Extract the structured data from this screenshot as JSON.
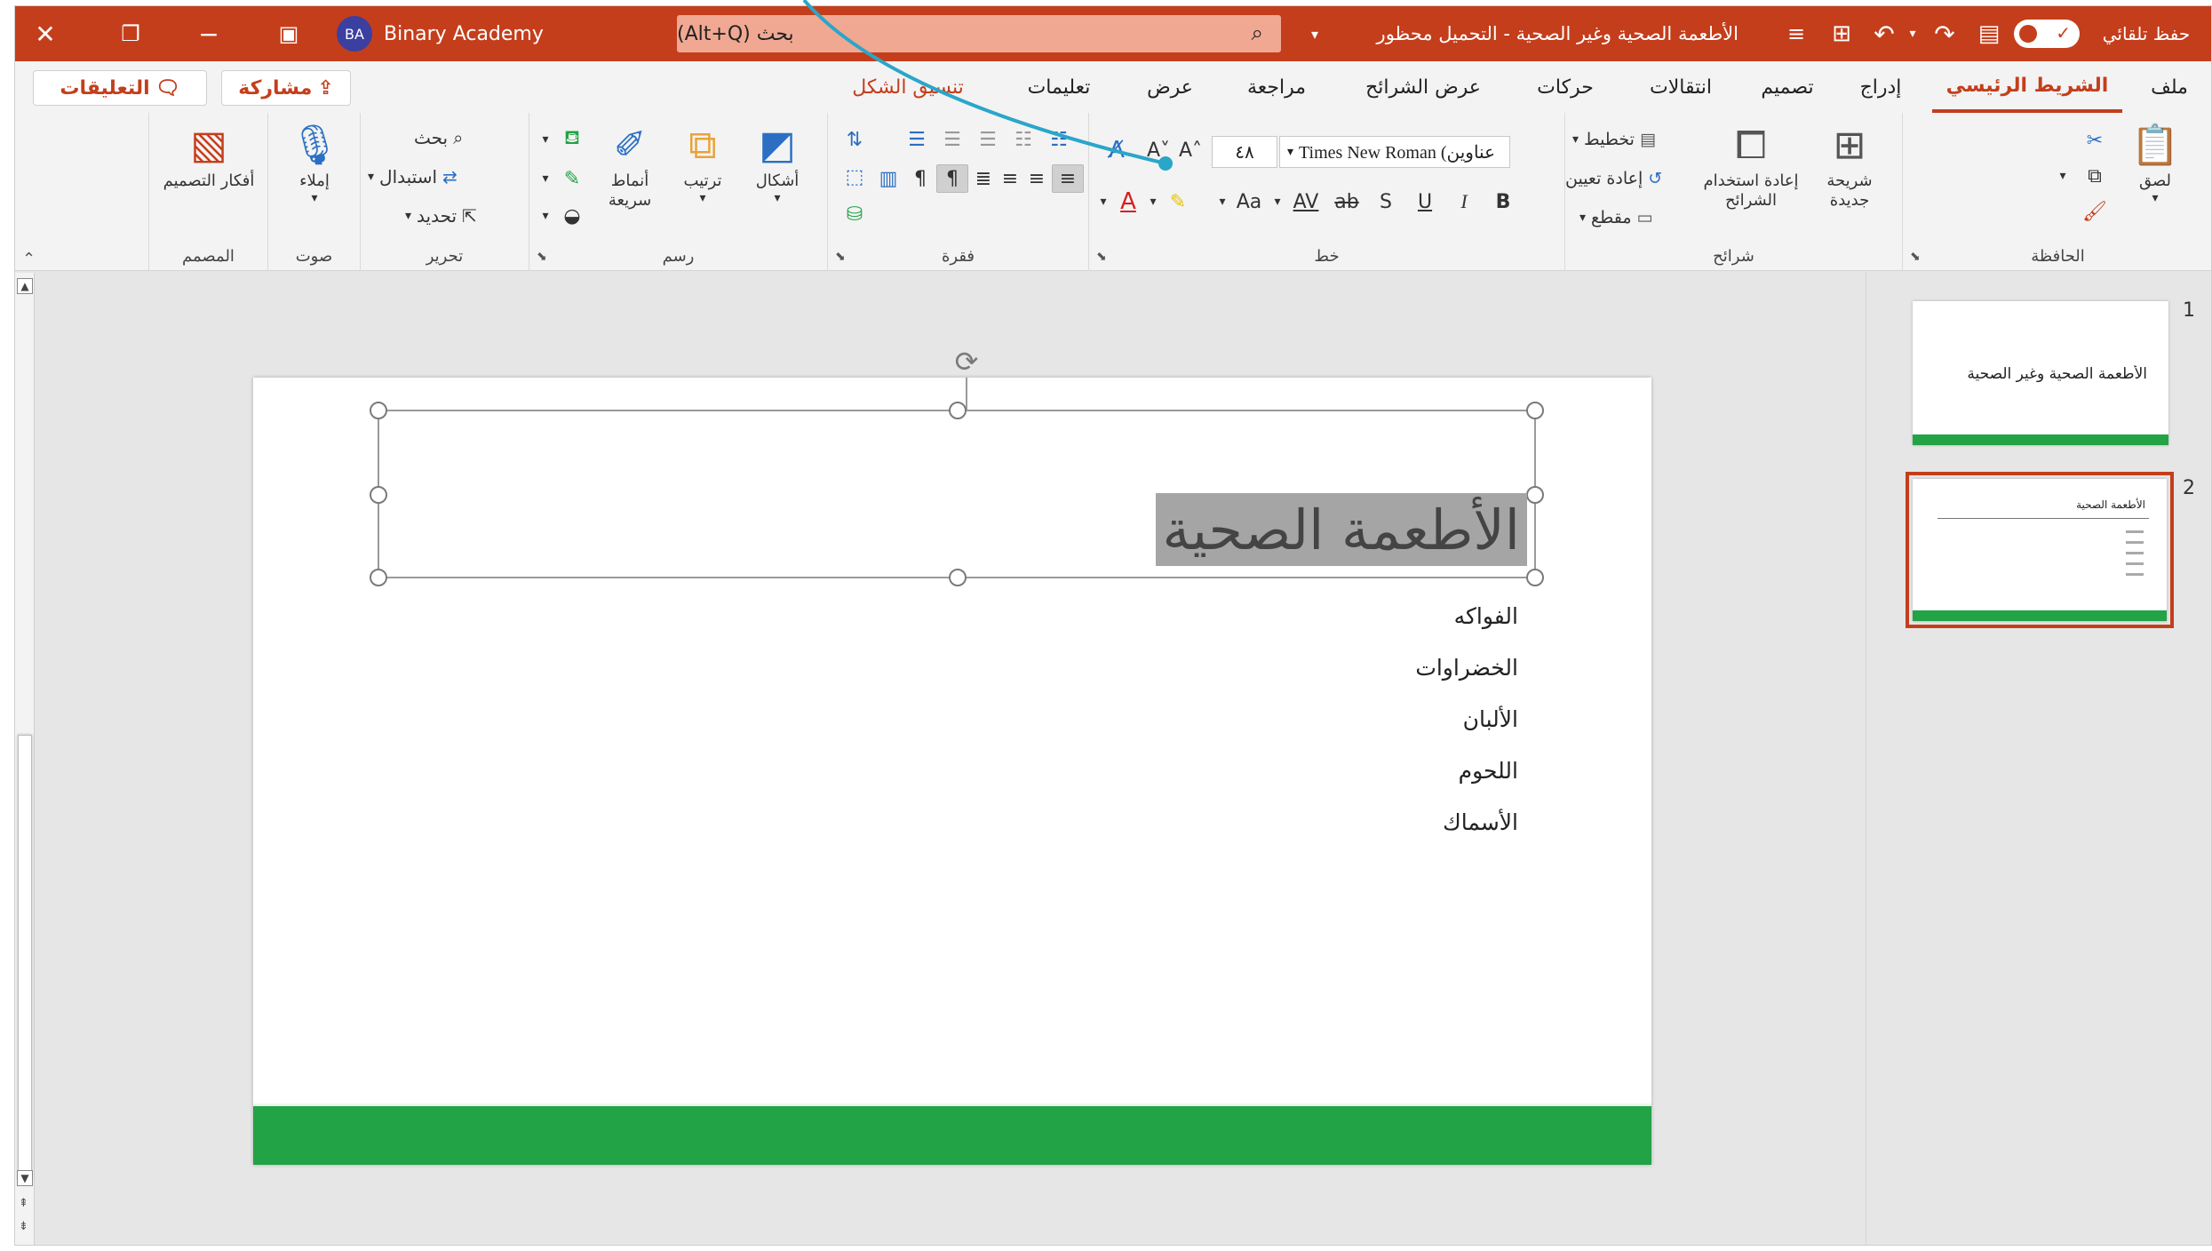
{
  "titlebar": {
    "autosave_label": "حفظ تلقائي",
    "doc_title": "الأطعمة الصحية وغير الصحية - التحميل محظور",
    "search_placeholder": "بحث (Alt+Q)",
    "user_name": "Binary Academy",
    "user_initials": "BA",
    "bg_color": "#c43e1c"
  },
  "tabs": {
    "file": "ملف",
    "home": "الشريط الرئيسي",
    "insert": "إدراج",
    "design": "تصميم",
    "transitions": "انتقالات",
    "animations": "حركات",
    "slideshow": "عرض الشرائح",
    "review": "مراجعة",
    "view": "عرض",
    "help": "تعليمات",
    "shape_format": "تنسيق الشكل",
    "share": "مشاركة",
    "comments": "التعليقات"
  },
  "ribbon": {
    "clipboard": {
      "paste": "لصق",
      "label": "الحافظة"
    },
    "slides": {
      "new_slide": "شريحة جديدة",
      "reuse_slides": "إعادة استخدام الشرائح",
      "layout": "تخطيط",
      "reset": "إعادة تعيين",
      "section": "مقطع",
      "label": "شرائح"
    },
    "font": {
      "font_name": "Times New Roman (عناوين",
      "font_size": "٤٨",
      "bold": "B",
      "italic": "I",
      "underline": "U",
      "shadow": "S",
      "strike": "ab",
      "spacing": "AV",
      "case": "Aa",
      "label": "خط"
    },
    "paragraph": {
      "label": "فقرة"
    },
    "drawing": {
      "shapes": "أشكال",
      "arrange": "ترتيب",
      "quick_styles": "أنماط سريعة",
      "label": "رسم"
    },
    "editing": {
      "find": "بحث",
      "replace": "استبدال",
      "select": "تحديد",
      "label": "تحرير"
    },
    "voice": {
      "dictate": "إملاء",
      "label": "صوت"
    },
    "designer": {
      "design_ideas": "أفكار التصميم",
      "label": "المصمم"
    }
  },
  "slide": {
    "title": "الأطعمة الصحية",
    "bullets": [
      "الفواكه",
      "الخضراوات",
      "الألبان",
      "اللحوم",
      "الأسماك"
    ],
    "accent_color": "#22a345"
  },
  "thumbnails": [
    {
      "number": "1",
      "title": "الأطعمة الصحية وغير الصحية"
    },
    {
      "number": "2",
      "title": "الأطعمة الصحية"
    }
  ]
}
